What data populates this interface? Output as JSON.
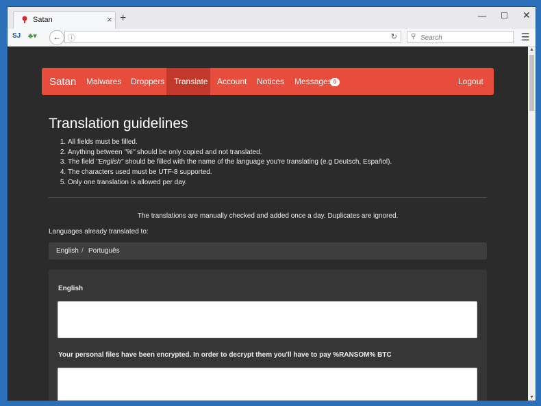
{
  "browser": {
    "tab_title": "Satan",
    "new_tab_symbol": "+",
    "search_placeholder": "Search",
    "site_icon_text": "SJ"
  },
  "site_nav": {
    "brand": "Satan",
    "items": [
      "Malwares",
      "Droppers",
      "Translate",
      "Account",
      "Notices",
      "Messages"
    ],
    "active_item": "Translate",
    "messages_badge": "0",
    "logout": "Logout"
  },
  "content": {
    "title": "Translation guidelines",
    "rules": [
      "All fields must be filled.",
      "The field \"English\" should be filled with the name of the language you're translating (e.g Deutsch, Español).",
      "The characters used must be UTF-8 supported.",
      "Only one translation is allowed per day."
    ],
    "rule2_prefix": "Anything between ",
    "rule2_em": "\"%\"",
    "rule2_suffix": " should be only copied and not translated.",
    "rule3_prefix": "The field ",
    "rule3_em": "\"English\"",
    "rule3_suffix": " should be filled with the name of the language you're translating (e.g Deutsch, Español).",
    "notice": "The translations are manually checked and added once a day. Duplicates are ignored.",
    "languages_label": "Languages already translated to:",
    "languages": [
      "English",
      "Português"
    ],
    "languages_separator": "/",
    "form": {
      "field1_label": "English",
      "field2_label": "Your personal files have been encrypted. In order to decrypt them you'll have to pay %RANSOM% BTC"
    }
  },
  "colors": {
    "nav_bg": "#e74c3c",
    "nav_active": "#c0392b",
    "page_bg": "#2b2b2b"
  },
  "icons": [
    "favicon-icon",
    "close-icon",
    "back-arrow-icon",
    "info-icon",
    "reload-icon",
    "search-icon",
    "hamburger-menu-icon",
    "minimize-icon",
    "maximize-icon",
    "window-close-icon"
  ]
}
